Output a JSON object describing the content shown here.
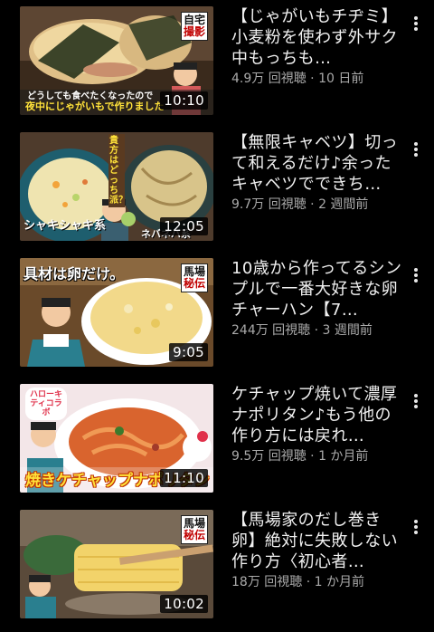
{
  "videos": [
    {
      "title": "【じゃがいもチヂミ】小麦粉を使わず外サク中もっちも…",
      "views": "4.9万 回視聴",
      "age": "10 日前",
      "duration": "10:10",
      "thumb_badge": [
        "自宅",
        "撮影"
      ],
      "thumb_caption_1": "どうしても食べたくなったので",
      "thumb_caption_2": "夜中にじゃがいもで作りました"
    },
    {
      "title": "【無限キャベツ】切って和えるだけ♪余ったキャベツでできち…",
      "views": "9.7万 回視聴",
      "age": "2 週間前",
      "duration": "12:05",
      "thumb_caption_1": "貴方はどっち派？",
      "thumb_caption_2": "シャキシャキ系",
      "thumb_caption_3": "ネバネバ系"
    },
    {
      "title": "10歳から作ってるシンプルで一番大好きな卵チャーハン【7…",
      "views": "244万 回視聴",
      "age": "3 週間前",
      "duration": "9:05",
      "thumb_badge": [
        "馬場",
        "秘伝"
      ],
      "thumb_caption_1": "具材は卵だけ。"
    },
    {
      "title": "ケチャップ焼いて濃厚ナポリタン♪もう他の作り方には戻れ…",
      "views": "9.5万 回視聴",
      "age": "1 か月前",
      "duration": "11:10",
      "thumb_caption_1": "ハローキティコラボ",
      "thumb_caption_2": "焼きケチャップナポリタン"
    },
    {
      "title": "【馬場家のだし巻き卵】絶対に失敗しない作り方〈初心者…",
      "views": "18万 回視聴",
      "age": "1 か月前",
      "duration": "10:02",
      "thumb_badge": [
        "馬場",
        "秘伝"
      ]
    }
  ],
  "separator": " · ",
  "colors": {
    "background": "#000000",
    "title": "#f1f1f1",
    "meta": "#aaaaaa"
  },
  "icons": {
    "menu": "more-vert-icon"
  }
}
